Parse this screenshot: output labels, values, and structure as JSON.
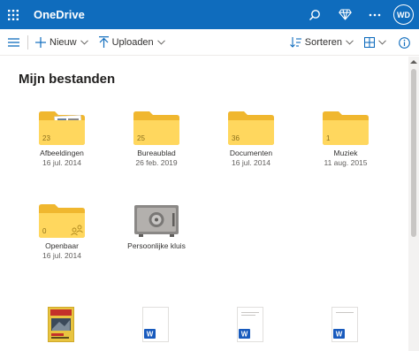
{
  "header": {
    "app_title": "OneDrive",
    "user_initials": "WD",
    "icons": [
      "waffle-icon",
      "search-icon",
      "diamond-icon",
      "more-icon"
    ]
  },
  "toolbar": {
    "new_label": "Nieuw",
    "upload_label": "Uploaden",
    "sort_label": "Sorteren"
  },
  "main": {
    "title": "Mijn bestanden",
    "items": [
      {
        "name": "Afbeeldingen",
        "date": "16 jul. 2014",
        "count": "23"
      },
      {
        "name": "Bureaublad",
        "date": "26 feb. 2019",
        "count": "25"
      },
      {
        "name": "Documenten",
        "date": "16 jul. 2014",
        "count": "36"
      },
      {
        "name": "Muziek",
        "date": "11 aug. 2015",
        "count": "1"
      },
      {
        "name": "Openbaar",
        "date": "16 jul. 2014",
        "count": "0"
      },
      {
        "name": "Persoonlijke kluis"
      }
    ],
    "file_badge": "W"
  },
  "colors": {
    "header_bg": "#0f6cbd",
    "folder_yellow": "#ffd75e",
    "folder_tab": "#f0b72f",
    "word_blue": "#185abd"
  }
}
